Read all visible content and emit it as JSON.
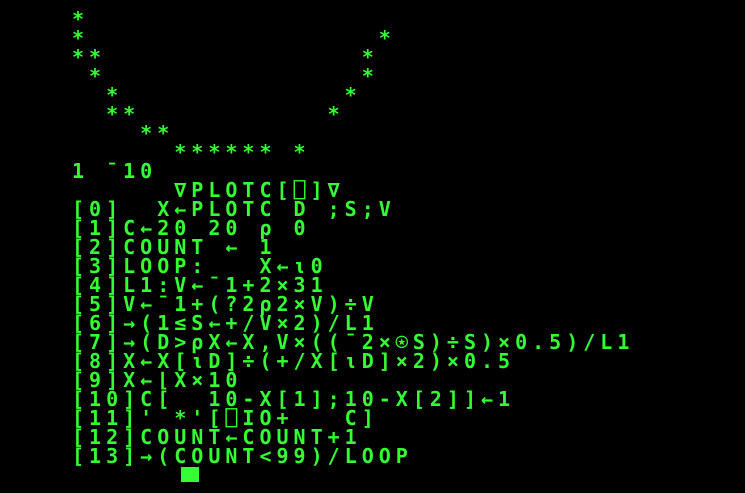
{
  "colors": {
    "background": "#000000",
    "text": "#33ff33"
  },
  "terminal": {
    "lines": [
      "*",
      "*                 *",
      "**               *",
      " *               *",
      "  *             *",
      "  **           *",
      "    **",
      "      ****** *",
      "1 ¯10",
      "      ∇PLOTC[⎕]∇",
      "[0]  X←PLOTC D ;S;V",
      "[1]C←20 20 ⍴ 0",
      "[2]COUNT ← 1",
      "[3]LOOP:   X←⍳0",
      "[4]L1:V←¯1+2×31",
      "[5]V←¯1+(?2⍴2×V)÷V",
      "[6]→(1≤S←+/V×2)/L1",
      "[7]→(D>⍴X←X,V×((¯2×⍟S)÷S)×0.5)/L1",
      "[8]X←X[⍳D]÷(+/X[⍳D]×2)×0.5",
      "[9]X←⌊X×10",
      "[10]C[  10-X[1];10-X[2]]←1",
      "[11]' *'[⎕IO+   C]",
      "[12]COUNT←COUNT+1",
      "[13]→(COUNT<99)/LOOP"
    ]
  },
  "cursor": {
    "visible": true
  }
}
